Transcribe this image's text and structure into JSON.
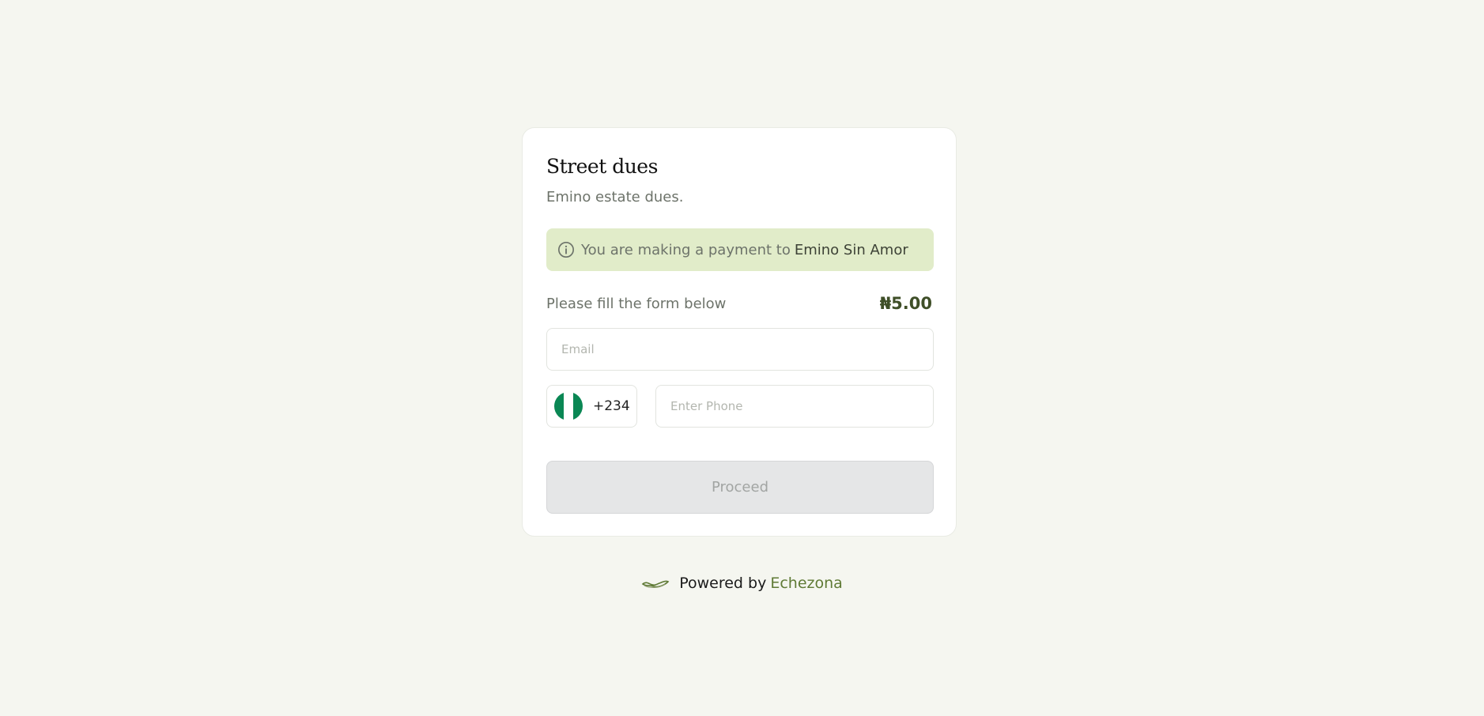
{
  "card": {
    "title": "Street dues",
    "subtitle": "Emino estate dues."
  },
  "notice": {
    "icon": "info-icon",
    "prefix": "You are making a payment to",
    "payee": "Emino Sin Amor"
  },
  "form": {
    "label": "Please fill the form below",
    "amount": "₦5.00",
    "email_placeholder": "Email",
    "country_flag": "nigeria-flag-icon",
    "dial_code": "+234",
    "phone_placeholder": "Enter Phone",
    "proceed_label": "Proceed"
  },
  "footer": {
    "powered_by": "Powered by",
    "brand": "Echezona"
  },
  "colors": {
    "background": "#f5f6f0",
    "notice_bg": "#e1ecc9",
    "amount": "#3f4f28",
    "brand": "#5f7a35",
    "flag_green": "#0a8754"
  }
}
